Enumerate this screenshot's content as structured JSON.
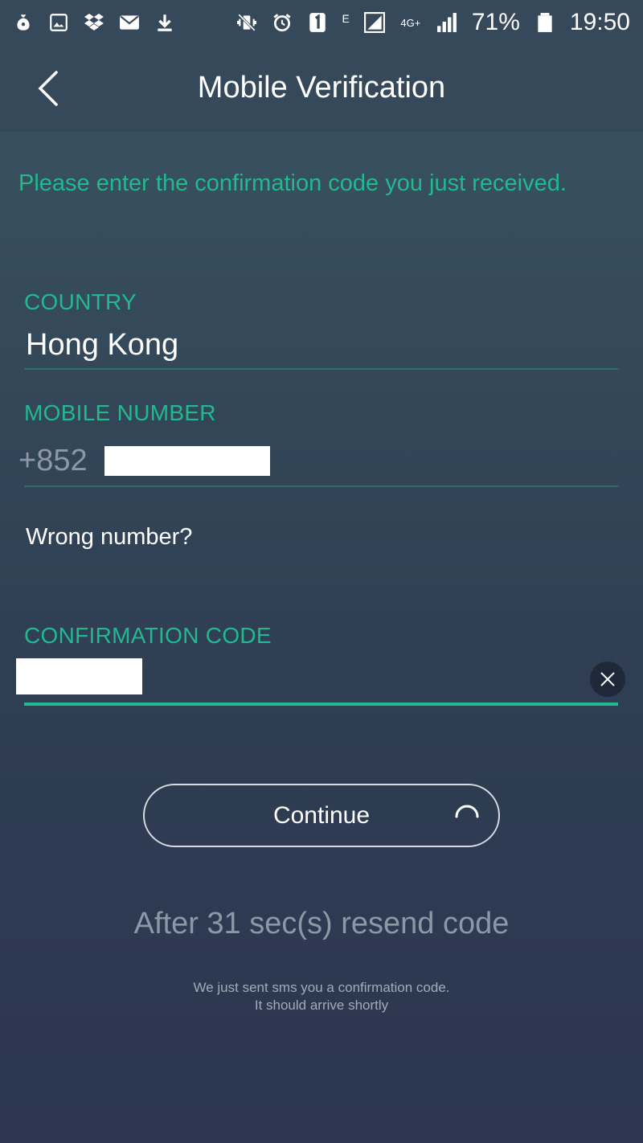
{
  "status_bar": {
    "left_icons": [
      "money-bag-icon",
      "gallery-icon",
      "dropbox-icon",
      "mail-icon",
      "download-icon"
    ],
    "right_icons": [
      "vibrate-mute-icon",
      "alarm-icon",
      "sim-1-icon",
      "network-e-icon",
      "signal-icon",
      "4g-plus-icon",
      "signal-icon"
    ],
    "network_label": "E",
    "lte_label": "4G+",
    "battery_percent": "71%",
    "time": "19:50"
  },
  "app_bar": {
    "title": "Mobile Verification"
  },
  "instruction": "Please enter the confirmation code you just received.",
  "country": {
    "label": "COUNTRY",
    "value": "Hong Kong"
  },
  "mobile": {
    "label": "MOBILE NUMBER",
    "prefix": "+852"
  },
  "wrong_number": "Wrong number?",
  "confirmation": {
    "label": "CONFIRMATION CODE"
  },
  "continue_label": "Continue",
  "resend_text": "After 31 sec(s) resend code",
  "note_line1": "We just sent sms you a confirmation code.",
  "note_line2": "It should arrive shortly",
  "colors": {
    "accent": "#22b890",
    "header": "#36495a",
    "muted_text": "#8c98a6"
  }
}
